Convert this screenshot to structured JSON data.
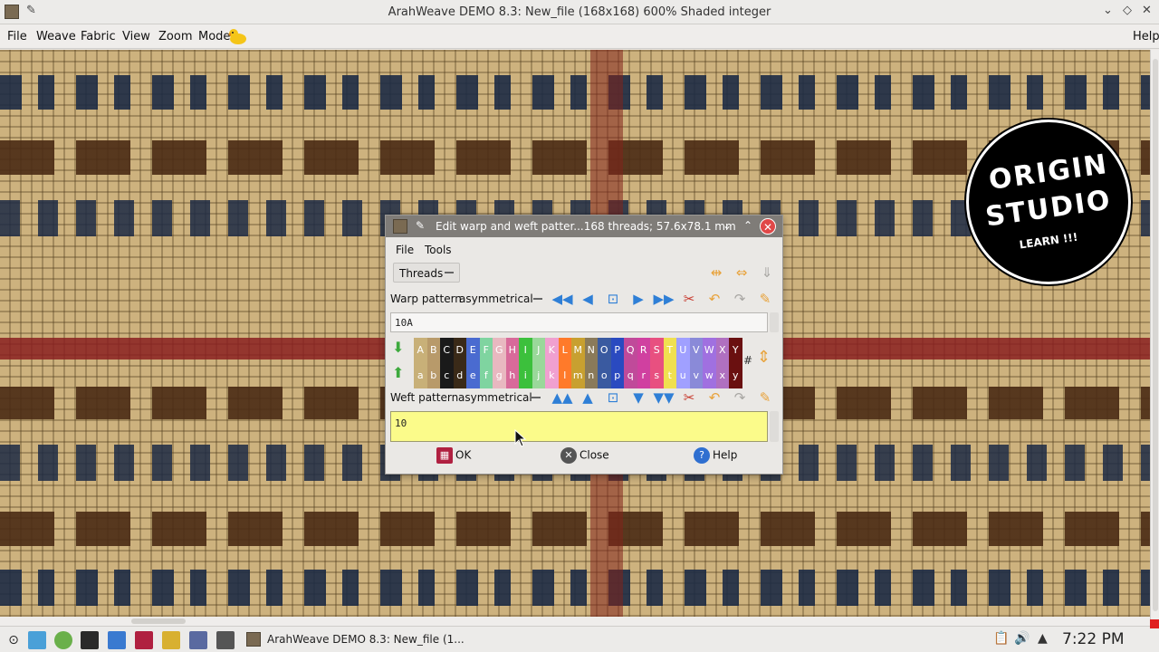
{
  "window": {
    "title": "ArahWeave DEMO 8.3: New_file (168x168) 600% Shaded integer"
  },
  "menubar": {
    "items": [
      "File",
      "Weave",
      "Fabric",
      "View",
      "Zoom",
      "Mode"
    ],
    "help": "Help"
  },
  "logo": {
    "line1": "ORIGIN",
    "line2": "STUDIO",
    "line3": "LEARN !!!"
  },
  "dialog": {
    "title": "Edit warp and weft patter...168 threads; 57.6x78.1 mm",
    "menu": [
      "File",
      "Tools"
    ],
    "mode_combo": "Threads",
    "warp": {
      "label": "Warp pattern",
      "symmetry": "asymmetrical",
      "value": "10A"
    },
    "weft": {
      "label": "Weft pattern",
      "symmetry": "asymmetrical",
      "value": "10"
    },
    "palette_upper": [
      "A",
      "B",
      "C",
      "D",
      "E",
      "F",
      "G",
      "H",
      "I",
      "J",
      "K",
      "L",
      "M",
      "N",
      "O",
      "P",
      "Q",
      "R",
      "S",
      "T",
      "U",
      "V",
      "W",
      "X",
      "Y"
    ],
    "palette_lower": [
      "a",
      "b",
      "c",
      "d",
      "e",
      "f",
      "g",
      "h",
      "i",
      "j",
      "k",
      "l",
      "m",
      "n",
      "o",
      "p",
      "q",
      "r",
      "s",
      "t",
      "u",
      "v",
      "w",
      "x",
      "y"
    ],
    "palette_colors": [
      "#c8b078",
      "#b89a6a",
      "#1a1a1a",
      "#3a2a18",
      "#4a6bd0",
      "#7fd4a0",
      "#e8b8c0",
      "#d86a9a",
      "#3cc03c",
      "#9ad89a",
      "#f0a0d0",
      "#ff7a2a",
      "#c8a030",
      "#8a7a5a",
      "#3a5aa0",
      "#2a4ac0",
      "#c04a9a",
      "#d040a0",
      "#e85080",
      "#f0e050",
      "#a0a0ff",
      "#8a8ad8",
      "#a070e0",
      "#b070c0",
      "#6a1010"
    ],
    "hash": "#",
    "buttons": {
      "ok": "OK",
      "close": "Close",
      "help": "Help"
    }
  },
  "taskbar": {
    "entry": "ArahWeave DEMO 8.3: New_file (1...",
    "clock": "7:22 PM"
  },
  "colors": {
    "fabric_base": "#cdb27e",
    "navy": "#1c2a44",
    "brown": "#4a2a14",
    "red": "#8a2020",
    "weft_field": "#fbfb8a"
  }
}
